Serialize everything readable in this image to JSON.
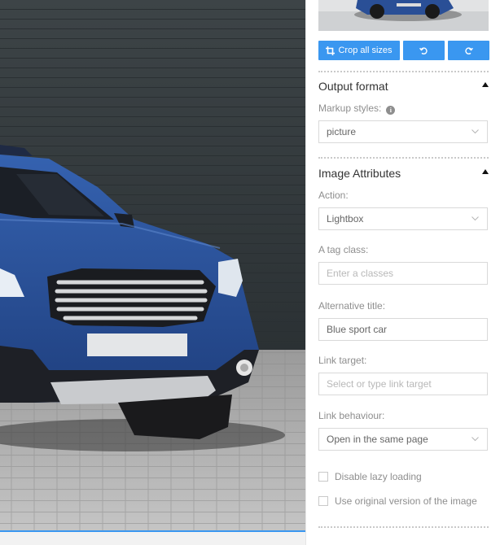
{
  "toolbar": {
    "crop_label": "Crop all sizes",
    "crop_icon": "crop-icon",
    "rotate_left_icon": "rotate-left-icon",
    "rotate_right_icon": "rotate-right-icon"
  },
  "output_format": {
    "title": "Output format",
    "markup_label": "Markup styles:",
    "markup_value": "picture"
  },
  "image_attributes": {
    "title": "Image Attributes",
    "action_label": "Action:",
    "action_value": "Lightbox",
    "a_tag_class_label": "A tag class:",
    "a_tag_class_placeholder": "Enter a classes",
    "alt_title_label": "Alternative title:",
    "alt_title_value": "Blue sport car",
    "link_target_label": "Link target:",
    "link_target_placeholder": "Select or type link target",
    "link_behaviour_label": "Link behaviour:",
    "link_behaviour_value": "Open in the same page",
    "disable_lazy_label": "Disable lazy loading",
    "use_original_label": "Use original version of the image"
  },
  "colors": {
    "accent": "#3a97f0",
    "car_body": "#2a4f96"
  }
}
